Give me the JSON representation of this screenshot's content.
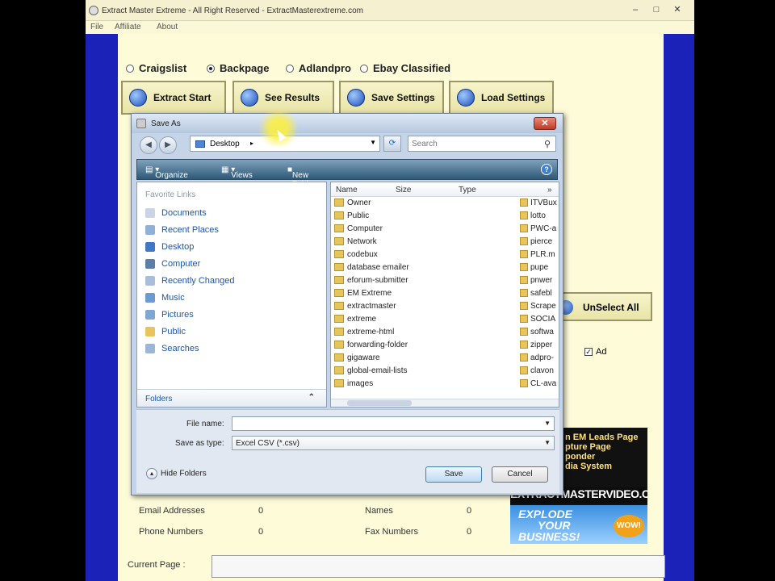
{
  "window": {
    "title": "Extract Master Extreme - All Right  Reserved - ExtractMasterextreme.com",
    "min": "–",
    "max": "□",
    "close": "✕"
  },
  "menu": [
    "File",
    "Affiliate",
    "About"
  ],
  "sources": [
    {
      "label": "Craigslist",
      "selected": false
    },
    {
      "label": "Backpage",
      "selected": true
    },
    {
      "label": "Adlandpro",
      "selected": false
    },
    {
      "label": "Ebay Classified",
      "selected": false
    }
  ],
  "toolbar": {
    "extract_start": "Extract Start",
    "see_results": "See Results",
    "save_settings": "Save Settings",
    "load_settings": "Load Settings"
  },
  "unselect_all": "UnSelect All",
  "ad_checkbox": {
    "label": "Ad",
    "checked": true
  },
  "stats": {
    "email_label": "Email Addresses",
    "email_value": "0",
    "phone_label": "Phone Numbers",
    "phone_value": "0",
    "names_label": "Names",
    "names_value": "0",
    "fax_label": "Fax Numbers",
    "fax_value": "0"
  },
  "current_page_label": "Current Page :",
  "ad_banner": {
    "line1": "n EM Leads Page",
    "line2": "pture Page",
    "line3": "ponder",
    "line4": "dia System",
    "url": "EXTRACTMASTERVIDEO.COM",
    "explode": "EXPLODE",
    "your": "YOUR",
    "business": "BUSINESS!",
    "wow": "WOW!"
  },
  "dialog": {
    "title": "Save As",
    "close": "✕",
    "address": "Desktop",
    "search_placeholder": "Search",
    "cmd": {
      "organize": "Organize",
      "views": "Views",
      "new_folder": "New Folder",
      "help": "?"
    },
    "favorite_links_header": "Favorite Links",
    "favorites": [
      "Documents",
      "Recent Places",
      "Desktop",
      "Computer",
      "Recently Changed",
      "Music",
      "Pictures",
      "Public",
      "Searches"
    ],
    "folders_label": "Folders",
    "columns": {
      "name": "Name",
      "size": "Size",
      "type": "Type",
      "more": "»"
    },
    "files": [
      "Owner",
      "Public",
      "Computer",
      "Network",
      "codebux",
      "database emailer",
      "eforum-submitter",
      "EM Extreme",
      "extractmaster",
      "extreme",
      "extreme-html",
      "forwarding-folder",
      "gigaware",
      "global-email-lists",
      "images"
    ],
    "files_col2": [
      "ITVBux",
      "lotto",
      "PWC-a",
      "pierce",
      "PLR.m",
      "pupe",
      "pnwer",
      "safebl",
      "Scrape",
      "SOCIA",
      "softwa",
      "zipper",
      "adpro-",
      "clavon",
      "CL-ava"
    ],
    "file_name_label": "File name:",
    "file_name_value": "",
    "save_type_label": "Save as type:",
    "save_type_value": "Excel CSV (*.csv)",
    "hide_folders": "Hide Folders",
    "save": "Save",
    "cancel": "Cancel"
  }
}
